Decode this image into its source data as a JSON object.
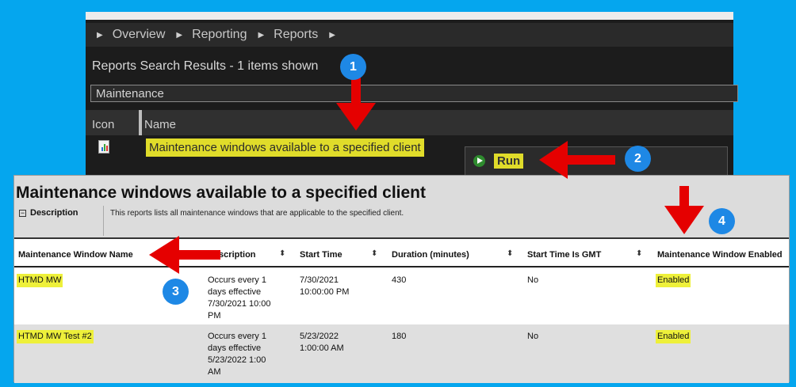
{
  "console": {
    "breadcrumb": [
      "Overview",
      "Reporting",
      "Reports"
    ],
    "results_header": "Reports Search Results  -  1 items shown",
    "search_value": "Maintenance",
    "columns": {
      "icon": "Icon",
      "name": "Name"
    },
    "result_name": "Maintenance windows available to a specified client",
    "context_menu": {
      "run_label": "Run"
    }
  },
  "report": {
    "title": "Maintenance windows available to a specified client",
    "description_label": "Description",
    "description_text": "This reports lists all maintenance windows that are applicable to the specified client.",
    "columns": [
      "Maintenance Window Name",
      "Description",
      "Start Time",
      "Duration (minutes)",
      "Start Time Is GMT",
      "Maintenance Window Enabled"
    ],
    "rows": [
      {
        "name": "HTMD MW",
        "description": [
          "Occurs every 1",
          "days effective",
          "7/30/2021 10:00",
          "PM"
        ],
        "start_time": [
          "7/30/2021",
          "10:00:00 PM"
        ],
        "duration": "430",
        "gmt": "No",
        "enabled": "Enabled"
      },
      {
        "name": "HTMD MW Test #2",
        "description": [
          "Occurs every 1",
          "days effective",
          "5/23/2022 1:00",
          "AM"
        ],
        "start_time": [
          "5/23/2022",
          "1:00:00 AM"
        ],
        "duration": "180",
        "gmt": "No",
        "enabled": "Enabled"
      }
    ]
  },
  "annotations": {
    "badges": [
      "1",
      "2",
      "3",
      "4"
    ]
  },
  "colors": {
    "background": "#05a6ee",
    "highlight": "#eef03a",
    "arrow": "#e50000",
    "badge": "#1e88e5"
  }
}
